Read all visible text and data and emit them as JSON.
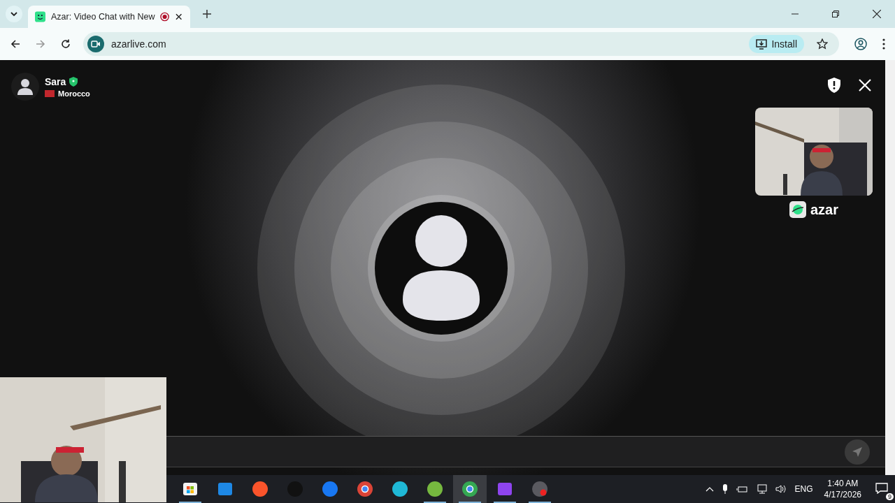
{
  "browser": {
    "tabs": [
      {
        "title": "Azar: Video Chat with New",
        "selected": true,
        "recording": true
      }
    ],
    "url": "azarlive.com",
    "install_label": "Install"
  },
  "call": {
    "partner": {
      "name": "Sara",
      "verified": true,
      "country": "Morocco"
    },
    "brand": "azar"
  },
  "taskbar": {
    "apps": [
      {
        "kind": "store",
        "running": true,
        "selected": false
      },
      {
        "kind": "mail",
        "running": false,
        "selected": false
      },
      {
        "kind": "brave",
        "running": false,
        "selected": false
      },
      {
        "kind": "tiktok",
        "running": false,
        "selected": false
      },
      {
        "kind": "facebook",
        "running": false,
        "selected": false
      },
      {
        "kind": "chrome",
        "running": false,
        "selected": false
      },
      {
        "kind": "canva",
        "running": false,
        "selected": false
      },
      {
        "kind": "torrent",
        "running": true,
        "selected": false
      },
      {
        "kind": "chrome-profile",
        "running": true,
        "selected": true
      },
      {
        "kind": "video-editor",
        "running": true,
        "selected": false
      },
      {
        "kind": "recorder",
        "running": true,
        "selected": false
      }
    ],
    "language": "ENG",
    "time": "1:40 AM",
    "date": "4/17/2026",
    "notifications": "9"
  }
}
